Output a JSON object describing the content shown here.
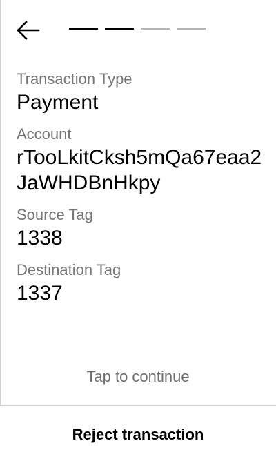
{
  "header": {
    "back_icon": "arrow-left-icon",
    "progress": {
      "total_steps": 4,
      "completed_steps": 2
    }
  },
  "fields": [
    {
      "label": "Transaction Type",
      "value": "Payment"
    },
    {
      "label": "Account",
      "value": "rTooLkitCksh5mQa67eaa2JaWHDBnHkpy"
    },
    {
      "label": "Source Tag",
      "value": "1338"
    },
    {
      "label": "Destination Tag",
      "value": "1337"
    }
  ],
  "hint": "Tap to continue",
  "reject_label": "Reject transaction",
  "colors": {
    "primary_text": "#000000",
    "secondary_text": "#767676",
    "progress_active": "#000000",
    "progress_inactive": "#b5b5b5",
    "divider": "#cfcfcf"
  }
}
